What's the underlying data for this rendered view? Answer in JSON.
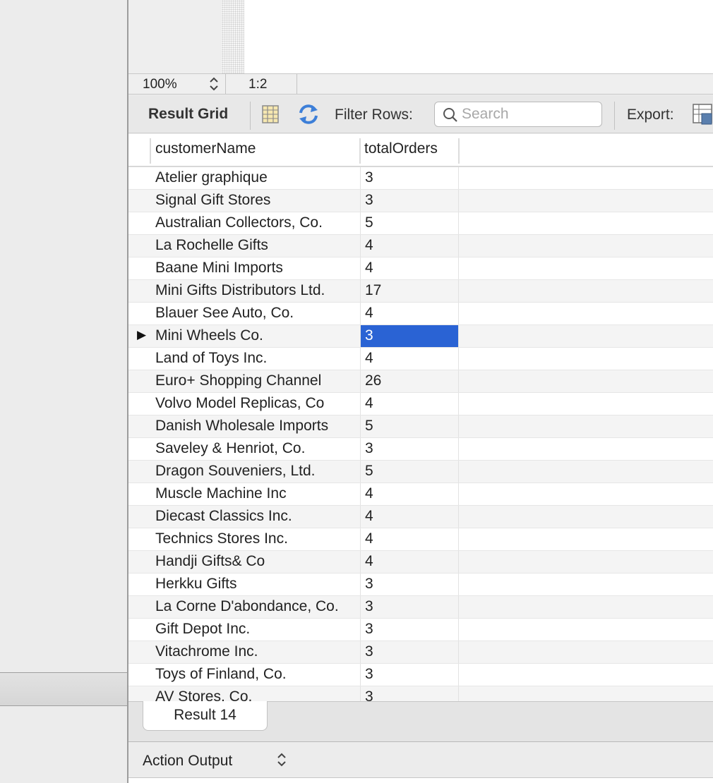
{
  "statusbar": {
    "zoom": "100%",
    "position": "1:2"
  },
  "toolbar": {
    "title": "Result Grid",
    "filter_label": "Filter Rows:",
    "search_placeholder": "Search",
    "export_label": "Export:"
  },
  "grid": {
    "columns": [
      "customerName",
      "totalOrders"
    ],
    "selected_row": 7,
    "rows": [
      {
        "name": "Atelier graphique",
        "orders": "3"
      },
      {
        "name": "Signal Gift Stores",
        "orders": "3"
      },
      {
        "name": "Australian Collectors, Co.",
        "orders": "5"
      },
      {
        "name": "La Rochelle Gifts",
        "orders": "4"
      },
      {
        "name": "Baane Mini Imports",
        "orders": "4"
      },
      {
        "name": "Mini Gifts Distributors Ltd.",
        "orders": "17"
      },
      {
        "name": "Blauer See Auto, Co.",
        "orders": "4"
      },
      {
        "name": "Mini Wheels Co.",
        "orders": "3"
      },
      {
        "name": "Land of Toys Inc.",
        "orders": "4"
      },
      {
        "name": "Euro+ Shopping Channel",
        "orders": "26"
      },
      {
        "name": "Volvo Model Replicas, Co",
        "orders": "4"
      },
      {
        "name": "Danish Wholesale Imports",
        "orders": "5"
      },
      {
        "name": "Saveley & Henriot, Co.",
        "orders": "3"
      },
      {
        "name": "Dragon Souveniers, Ltd.",
        "orders": "5"
      },
      {
        "name": "Muscle Machine Inc",
        "orders": "4"
      },
      {
        "name": "Diecast Classics Inc.",
        "orders": "4"
      },
      {
        "name": "Technics Stores Inc.",
        "orders": "4"
      },
      {
        "name": "Handji Gifts& Co",
        "orders": "4"
      },
      {
        "name": "Herkku Gifts",
        "orders": "3"
      },
      {
        "name": "La Corne D'abondance, Co.",
        "orders": "3"
      },
      {
        "name": "Gift Depot Inc.",
        "orders": "3"
      },
      {
        "name": "Vitachrome Inc.",
        "orders": "3"
      },
      {
        "name": "Toys of Finland, Co.",
        "orders": "3"
      },
      {
        "name": "AV Stores, Co.",
        "orders": "3"
      }
    ]
  },
  "result_tab": {
    "label": "Result 14"
  },
  "action_output": {
    "label": "Action Output"
  },
  "icons": {
    "grid_toggle": "column-grid-icon",
    "refresh": "refresh-icon",
    "search": "search-icon",
    "export": "export-grid-icon",
    "row_marker": "▶"
  },
  "colors": {
    "selection": "#2a63d4",
    "refresh_blue": "#3d7fd8"
  }
}
